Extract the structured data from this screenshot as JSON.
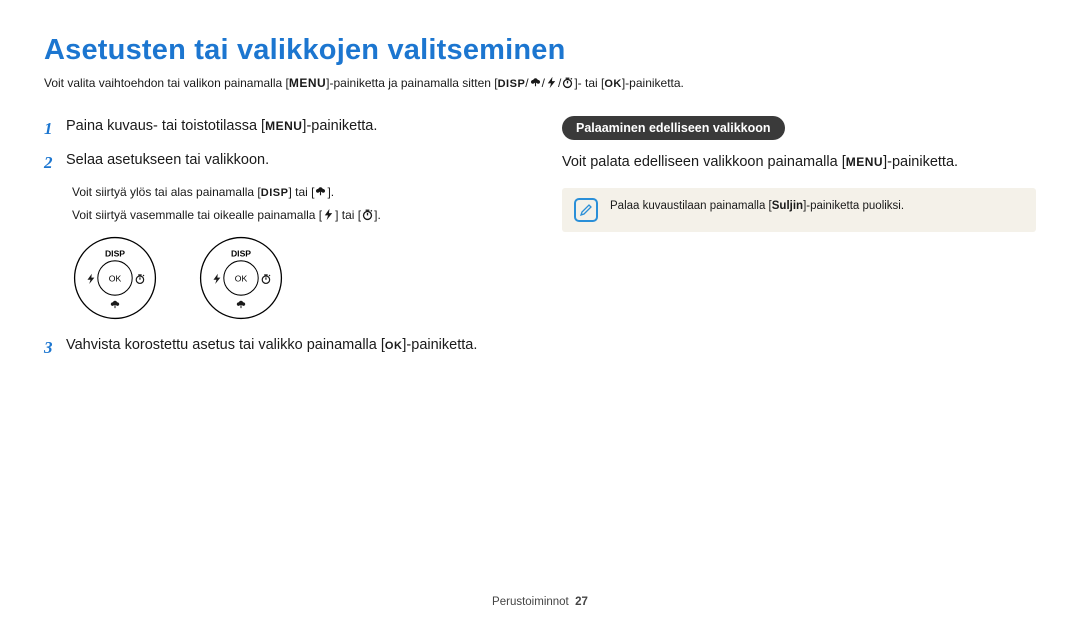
{
  "title": "Asetusten tai valikkojen valitseminen",
  "intro_a": "Voit valita vaihtoehdon tai valikon painamalla [",
  "intro_b": "]-painiketta ja painamalla sitten [",
  "intro_c": "]- tai [",
  "intro_d": "]-painiketta.",
  "labels": {
    "menu": "MENU",
    "disp": "DISP",
    "ok": "OK",
    "suljin": "Suljin"
  },
  "steps": {
    "s1_num": "1",
    "s1_a": "Paina kuvaus- tai toistotilassa [",
    "s1_b": "]-painiketta.",
    "s2_num": "2",
    "s2": "Selaa asetukseen tai valikkoon.",
    "s2_n1_a": "Voit siirtyä ylös tai alas painamalla [",
    "s2_n1_b": "] tai [",
    "s2_n1_c": "].",
    "s2_n2_a": "Voit siirtyä vasemmalle tai oikealle painamalla [",
    "s2_n2_b": "] tai [",
    "s2_n2_c": "].",
    "s3_num": "3",
    "s3_a": "Vahvista korostettu asetus tai valikko painamalla [",
    "s3_b": "]-painiketta."
  },
  "right": {
    "pill": "Palaaminen edelliseen valikkoon",
    "text_a": "Voit palata edelliseen valikkoon painamalla [",
    "text_b": "]-painiketta.",
    "callout_a": "Palaa kuvaustilaan painamalla [",
    "callout_b": "]-painiketta puoliksi."
  },
  "dial": {
    "top": "DISP",
    "center": "OK"
  },
  "footer": {
    "section": "Perustoiminnot",
    "page": "27"
  }
}
